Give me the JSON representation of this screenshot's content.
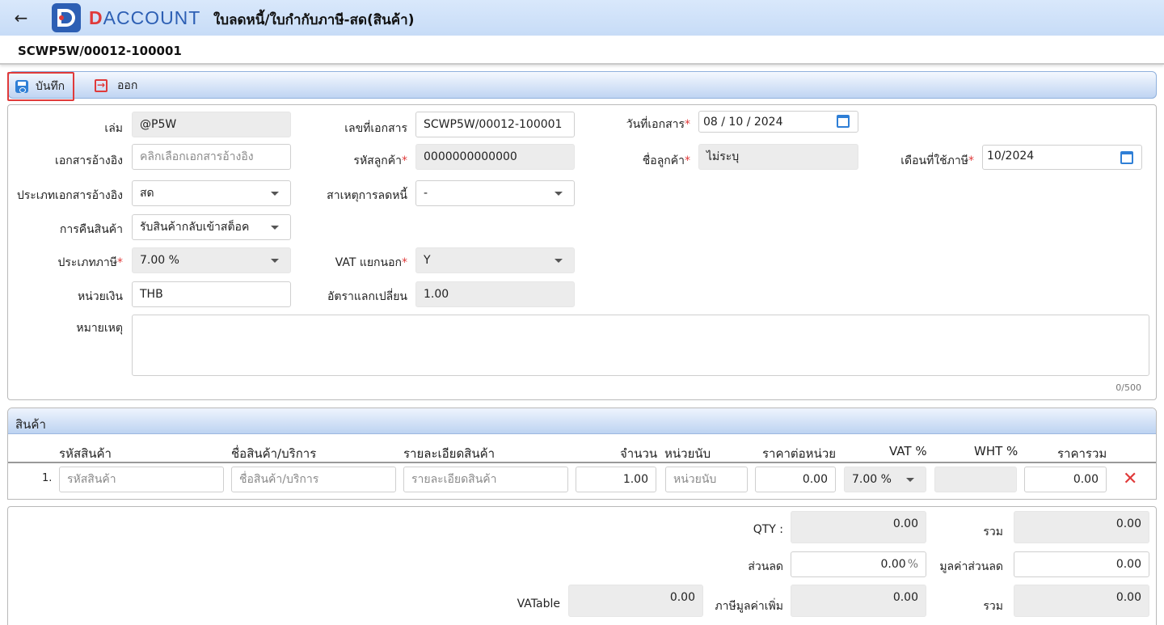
{
  "header": {
    "back_icon": "arrow-left-icon",
    "logo_text_first": "D",
    "logo_text_rest": "ACCOUNT",
    "title": "ใบลดหนี้/ใบกำกับภาษี-สด(สินค้า)"
  },
  "document_number": "SCWP5W/00012-100001",
  "toolbar": {
    "save_label": "บันทึก",
    "exit_label": "ออก"
  },
  "form": {
    "book_label": "เล่ม",
    "book_value": "@P5W",
    "docno_label": "เลขที่เอกสาร",
    "docno_value": "SCWP5W/00012-100001",
    "docdate_label": "วันที่เอกสาร",
    "docdate_value": "08 / 10 /  2024",
    "refdoc_label": "เอกสารอ้างอิง",
    "refdoc_placeholder": "คลิกเลือกเอกสารอ้างอิง",
    "custcode_label": "รหัสลูกค้า",
    "custcode_value": "0000000000000",
    "custname_label": "ชื่อลูกค้า",
    "custname_value": "ไม่ระบุ",
    "taxmonth_label": "เดือนที่ใช้ภาษี",
    "taxmonth_value": "10/2024",
    "reftype_label": "ประเภทเอกสารอ้างอิง",
    "reftype_value": "สด",
    "reason_label": "สาเหตุการลดหนี้",
    "reason_value": "-",
    "return_label": "การคืนสินค้า",
    "return_value": "รับสินค้ากลับเข้าสต็อค",
    "taxtype_label": "ประเภทภาษี",
    "taxtype_value": "7.00 %",
    "vatsep_label": "VAT แยกนอก",
    "vatsep_value": "Y",
    "currency_label": "หน่วยเงิน",
    "currency_value": "THB",
    "rate_label": "อัตราแลกเปลี่ยน",
    "rate_value": "1.00",
    "remark_label": "หมายเหตุ",
    "remark_counter": "0/500"
  },
  "products": {
    "title": "สินค้า",
    "columns": [
      "รหัสสินค้า",
      "ชื่อสินค้า/บริการ",
      "รายละเอียดสินค้า",
      "จำนวน",
      "หน่วยนับ",
      "ราคาต่อหน่วย",
      "VAT %",
      "WHT %",
      "ราคารวม"
    ],
    "rows": [
      {
        "num": "1.",
        "code_placeholder": "รหัสสินค้า",
        "name_placeholder": "ชื่อสินค้า/บริการ",
        "detail_placeholder": "รายละเอียดสินค้า",
        "qty": "1.00",
        "unit_placeholder": "หน่วยนับ",
        "price": "0.00",
        "vat": "7.00 %",
        "wht": "",
        "total": "0.00"
      }
    ]
  },
  "totals": {
    "qty_label": "QTY :",
    "qty_value": "0.00",
    "sum1_label": "รวม",
    "sum1_value": "0.00",
    "discount_label": "ส่วนลด",
    "discount_value": "0.00",
    "discount_unit": "%",
    "discount_amount_label": "มูลค่าส่วนลด",
    "discount_amount_value": "0.00",
    "vatable_label": "VATable",
    "vatable_value": "0.00",
    "vat_label": "ภาษีมูลค่าเพิ่ม",
    "vat_value": "0.00",
    "sum2_label": "รวม",
    "sum2_value": "0.00"
  },
  "colors": {
    "accent": "#2d5fb4",
    "danger": "#e03a3a",
    "header_bg": "#c7dcf7"
  }
}
